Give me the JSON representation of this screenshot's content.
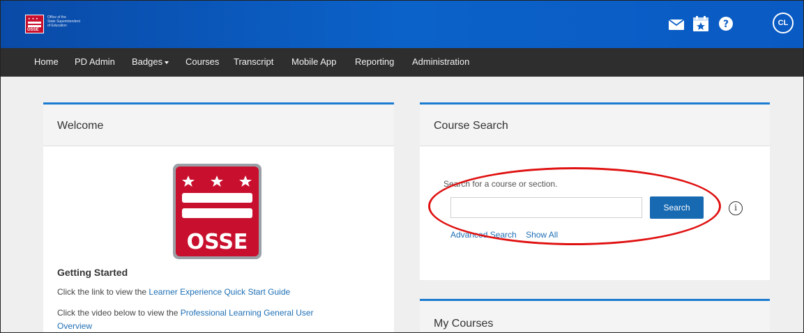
{
  "header": {
    "logo_text": "OSSE",
    "logo_caption": [
      "Office of the",
      "State Superintendent",
      "of Education"
    ],
    "icons": [
      "mail-icon",
      "calendar-star-icon",
      "help-icon"
    ],
    "avatar_initials": "CL",
    "brand_color": "#0b5fc7"
  },
  "nav": {
    "items": [
      "Home",
      "PD Admin",
      "Badges",
      "Courses",
      "Transcript",
      "Mobile App",
      "Reporting",
      "Administration"
    ]
  },
  "welcome": {
    "title": "Welcome",
    "logo_text": "OSSE",
    "heading": "Getting Started",
    "line1_prefix": "Click the link to view the ",
    "line1_link": "Learner Experience Quick Start Guide",
    "line2_prefix": "Click the video below to view the ",
    "line2_link_a": "Professional Learning General User",
    "line2_link_b": "Overview"
  },
  "course_search": {
    "title": "Course Search",
    "prompt": "Search for a course or section.",
    "input_value": "",
    "search_label": "Search",
    "info_glyph": "i",
    "advanced_label": "Advanced Search",
    "show_all_label": "Show All"
  },
  "my_courses": {
    "title": "My Courses"
  },
  "annotation": {
    "color": "#e01010"
  }
}
